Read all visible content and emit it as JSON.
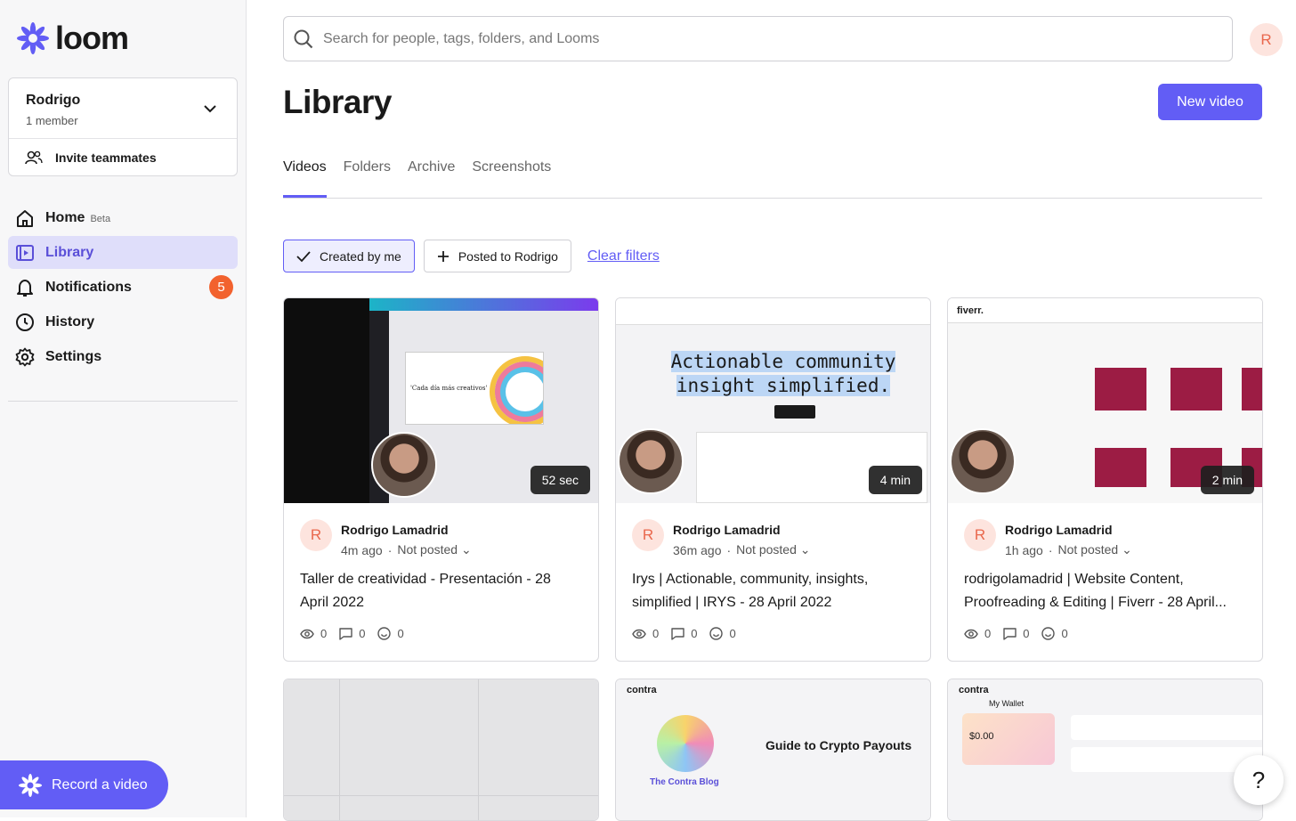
{
  "brand": {
    "name": "loom",
    "accent": "#625df5"
  },
  "workspace": {
    "name": "Rodrigo",
    "members": "1 member",
    "invite_label": "Invite teammates"
  },
  "nav": {
    "home": "Home",
    "home_tag": "Beta",
    "library": "Library",
    "notifications": "Notifications",
    "notifications_count": "5",
    "history": "History",
    "settings": "Settings"
  },
  "record_label": "Record a video",
  "search": {
    "placeholder": "Search for people, tags, folders, and Looms"
  },
  "user_initial": "R",
  "page_title": "Library",
  "new_video_label": "New video",
  "tabs": [
    "Videos",
    "Folders",
    "Archive",
    "Screenshots"
  ],
  "filters": {
    "created_by_me": "Created by me",
    "posted_to": "Posted to Rodrigo",
    "clear": "Clear filters"
  },
  "videos": [
    {
      "author": "Rodrigo Lamadrid",
      "time": "4m ago",
      "status": "Not posted",
      "duration": "52 sec",
      "title": "Taller de creatividad - Presentación - 28 April 2022",
      "views": "0",
      "comments": "0",
      "reactions": "0",
      "thumb_text": "'Cada día más creativos'"
    },
    {
      "author": "Rodrigo Lamadrid",
      "time": "36m ago",
      "status": "Not posted",
      "duration": "4 min",
      "title": "Irys | Actionable, community, insights, simplified | IRYS - 28 April 2022",
      "views": "0",
      "comments": "0",
      "reactions": "0",
      "thumb_text": "Actionable community insight simplified."
    },
    {
      "author": "Rodrigo Lamadrid",
      "time": "1h ago",
      "status": "Not posted",
      "duration": "2 min",
      "title": "rodrigolamadrid | Website Content, Proofreading & Editing | Fiverr - 28 April...",
      "views": "0",
      "comments": "0",
      "reactions": "0",
      "thumb_text": "fiverr."
    }
  ],
  "row2": [
    {
      "thumb_text": ""
    },
    {
      "thumb_text": "Guide to Crypto Payouts",
      "brand": "contra",
      "blog": "The Contra Blog"
    },
    {
      "thumb_text": "My Wallet",
      "brand": "contra",
      "balance": "$0.00"
    }
  ],
  "help_label": "?"
}
